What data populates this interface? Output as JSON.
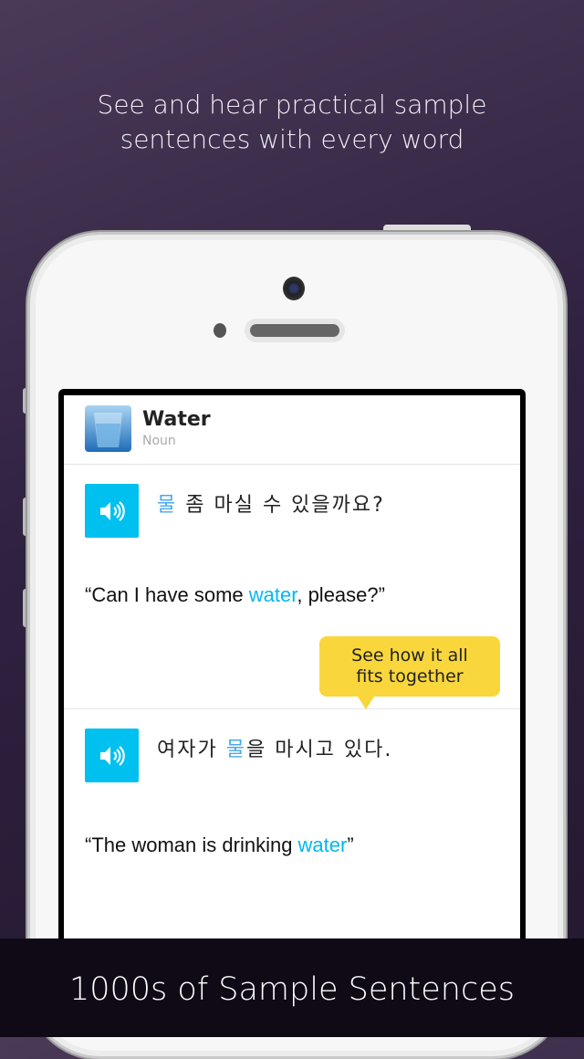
{
  "headline": {
    "line1": "See and hear practical sample",
    "line2": "sentences with every word"
  },
  "entry": {
    "word": "Water",
    "part_of_speech": "Noun",
    "thumbnail_icon": "water-glass-image"
  },
  "sentences": [
    {
      "ko_highlight": "물",
      "ko_rest": " 좀 마실 수 있을까요?",
      "ko_pre": "",
      "en_pre": "“Can I have some ",
      "en_highlight": "water",
      "en_post": ", please?”"
    },
    {
      "ko_pre": "여자가 ",
      "ko_highlight": "물",
      "ko_rest": "을 마시고 있다.",
      "en_pre": "“The woman is drinking ",
      "en_highlight": "water",
      "en_post": "”"
    }
  ],
  "tooltip": {
    "line1": "See how it all",
    "line2": "fits together"
  },
  "footer": {
    "text": "1000s of Sample Sentences"
  },
  "colors": {
    "accent": "#00c0f0",
    "tooltip": "#f9d63c",
    "footer": "#0f0a16"
  }
}
